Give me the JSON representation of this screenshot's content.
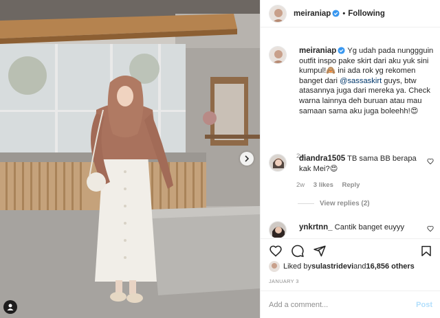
{
  "post": {
    "author": "meiraniap",
    "follow_status": "Following",
    "dot": "•"
  },
  "caption": {
    "username": "meiraniap",
    "text_part1": " Yg udah pada nunggguin outfit inspo pake skirt dari aku yuk sini kumpul!",
    "emoji1": "🙈",
    "text_part2": " ini ada rok yg rekomen banget dari ",
    "mention": "@sassaskirt",
    "text_part3": " guys, btw atasannya juga dari mereka ya. Check warna lainnya deh buruan atau mau samaan sama aku juga boleehh!",
    "emoji2": "😍",
    "time": "2w"
  },
  "comments": [
    {
      "username": "diandra1505",
      "text": " TB sama BB berapa kak Mei?",
      "emoji": "😍",
      "time": "2w",
      "likes": "3 likes",
      "reply": "Reply"
    },
    {
      "username": "ynkrtnn_",
      "text": " Cantik banget euyyy",
      "emoji": ""
    }
  ],
  "view_replies": "View replies (2)",
  "likes": {
    "prefix": "Liked by ",
    "user": "sulastridevi",
    "middle": " and ",
    "count": "16,856 others"
  },
  "date": "JANUARY 3",
  "add_comment": {
    "placeholder": "Add a comment...",
    "post_label": "Post"
  },
  "icons": {
    "verified": "verified-badge-icon",
    "like": "heart-icon",
    "comment": "comment-icon",
    "share": "paper-plane-icon",
    "save": "bookmark-icon",
    "next": "chevron-right-icon",
    "tag": "user-tag-icon"
  },
  "colors": {
    "verified": "#3897f0",
    "mention": "#00376b",
    "post_button_disabled": "#b2dffc",
    "secondary_text": "#8e8e8e"
  }
}
